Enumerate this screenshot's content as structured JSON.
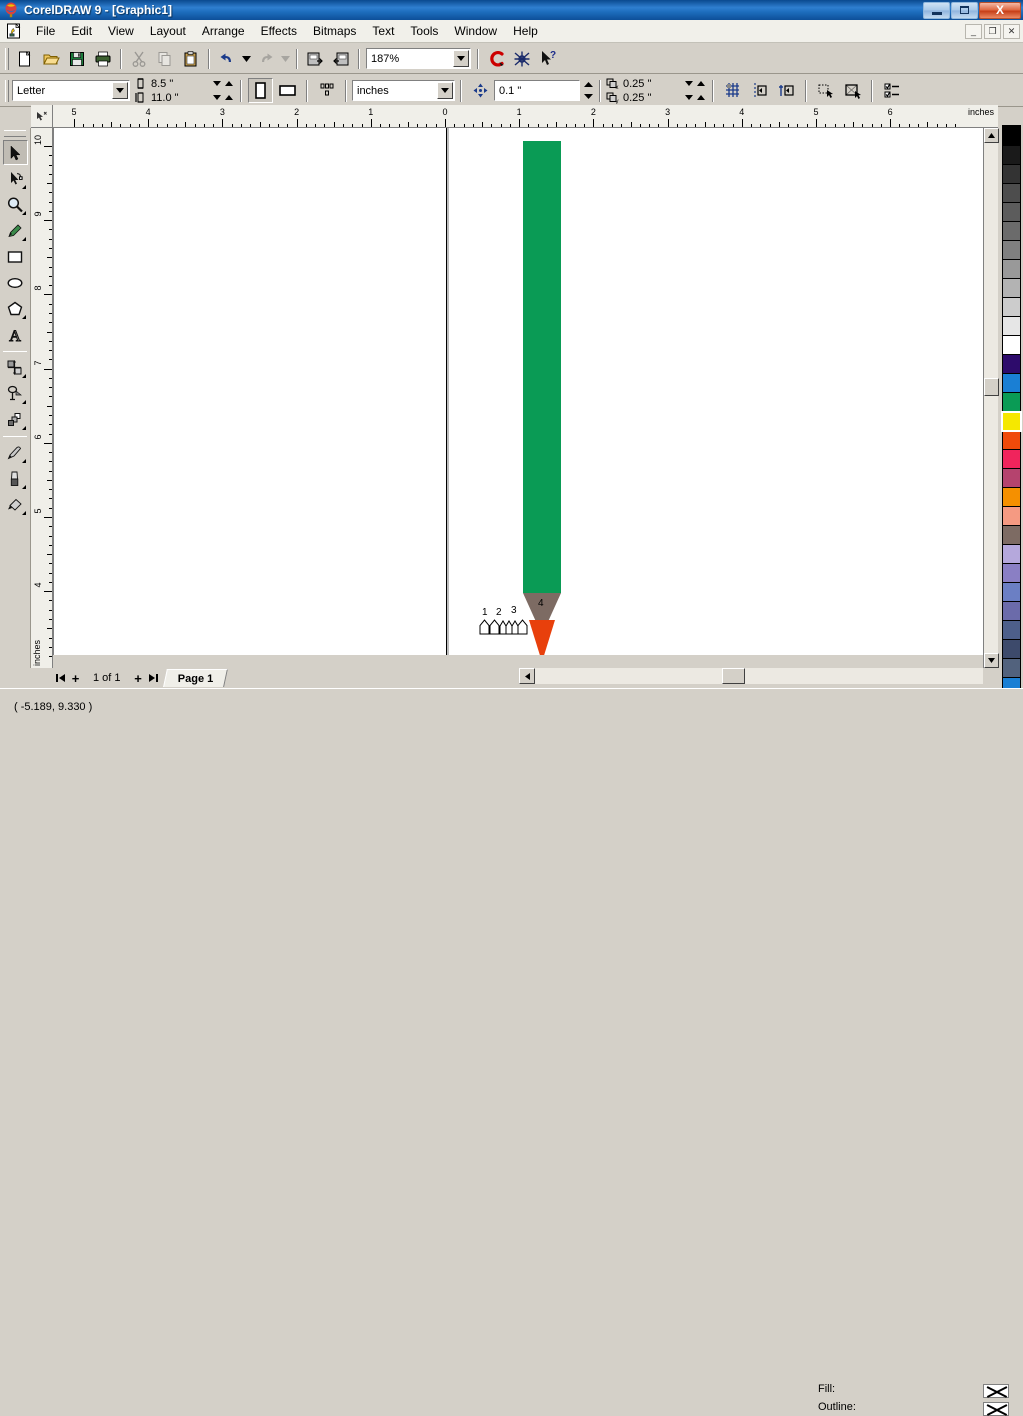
{
  "window": {
    "title": "CorelDRAW 9 - [Graphic1]",
    "app_icon": "corel-balloon-icon",
    "buttons": {
      "minimize": "minimize-icon",
      "restore": "restore-icon",
      "close": "X"
    },
    "doc_buttons": {
      "minimize": "_",
      "restore": "❐",
      "close": "✕"
    }
  },
  "menu": {
    "doc_icon": "document-icon",
    "items": [
      {
        "label": "File"
      },
      {
        "label": "Edit"
      },
      {
        "label": "View"
      },
      {
        "label": "Layout"
      },
      {
        "label": "Arrange"
      },
      {
        "label": "Effects"
      },
      {
        "label": "Bitmaps"
      },
      {
        "label": "Text"
      },
      {
        "label": "Tools"
      },
      {
        "label": "Window"
      },
      {
        "label": "Help"
      }
    ]
  },
  "toolbar": {
    "buttons": [
      {
        "name": "new-icon",
        "title": "New"
      },
      {
        "name": "open-icon",
        "title": "Open"
      },
      {
        "name": "save-icon",
        "title": "Save"
      },
      {
        "name": "print-icon",
        "title": "Print"
      },
      {
        "name": "cut-icon",
        "title": "Cut"
      },
      {
        "name": "copy-icon",
        "title": "Copy"
      },
      {
        "name": "paste-icon",
        "title": "Paste"
      },
      {
        "name": "undo-icon",
        "title": "Undo"
      },
      {
        "name": "redo-icon",
        "title": "Redo"
      },
      {
        "name": "import-icon",
        "title": "Import"
      },
      {
        "name": "export-icon",
        "title": "Export"
      },
      {
        "name": "application-launcher-icon",
        "title": "Application Launcher"
      },
      {
        "name": "corel-online-icon",
        "title": "Corel Online"
      },
      {
        "name": "whats-this-help-icon",
        "title": "What's This?"
      }
    ],
    "zoom_value": "187%"
  },
  "property_bar": {
    "paper_type": "Letter",
    "paper_width": "8.5 \"",
    "paper_height": "11.0 \"",
    "orientation_portrait": "portrait-icon",
    "orientation_landscape": "landscape-icon",
    "page_layout": "page-layout-icon",
    "units": "inches",
    "nudge_label": "nudge-icon",
    "nudge_offset": "0.1 \"",
    "duplicate_x_label": "x",
    "duplicate_x": "0.25 \"",
    "duplicate_y_label": "y",
    "duplicate_y": "0.25 \"",
    "buttons": [
      {
        "name": "snap-to-grid-icon"
      },
      {
        "name": "snap-to-guidelines-icon"
      },
      {
        "name": "snap-to-objects-icon"
      },
      {
        "name": "treat-as-filled-icon"
      },
      {
        "name": "wireframe-icon"
      },
      {
        "name": "options-icon"
      }
    ]
  },
  "toolbox": {
    "tools": [
      {
        "name": "pick-tool",
        "label": "Pick Tool",
        "active": true,
        "flyout": false
      },
      {
        "name": "shape-tool",
        "label": "Shape Tool",
        "active": false,
        "flyout": true
      },
      {
        "name": "zoom-tool",
        "label": "Zoom Tool",
        "active": false,
        "flyout": true
      },
      {
        "name": "freehand-tool",
        "label": "Freehand Tool",
        "active": false,
        "flyout": true
      },
      {
        "name": "rectangle-tool",
        "label": "Rectangle Tool",
        "active": false,
        "flyout": false
      },
      {
        "name": "ellipse-tool",
        "label": "Ellipse Tool",
        "active": false,
        "flyout": false
      },
      {
        "name": "polygon-tool",
        "label": "Polygon Tool",
        "active": false,
        "flyout": true
      },
      {
        "name": "text-tool",
        "label": "Text Tool",
        "active": false,
        "flyout": false
      },
      {
        "name": "interactive-blend-tool",
        "label": "Interactive Blend Tool",
        "active": false,
        "flyout": true
      },
      {
        "name": "eyedropper-tool",
        "label": "Eyedropper Tool",
        "active": false,
        "flyout": true
      },
      {
        "name": "interactive-extrude-tool",
        "label": "Interactive Extrude Tool",
        "active": false,
        "flyout": true
      },
      {
        "name": "outline-tool",
        "label": "Outline Tool",
        "active": false,
        "flyout": true
      },
      {
        "name": "fill-tool",
        "label": "Fill Tool",
        "active": false,
        "flyout": true
      },
      {
        "name": "interactive-fill-tool",
        "label": "Interactive Fill Tool",
        "active": false,
        "flyout": true
      }
    ]
  },
  "rulers": {
    "unit_label": "inches",
    "horizontal_labels": [
      "5",
      "4",
      "3",
      "2",
      "1",
      "0",
      "1",
      "2",
      "3",
      "4",
      "5",
      "6"
    ],
    "vertical_labels": [
      "10",
      "9",
      "8",
      "7",
      "6",
      "5",
      "4"
    ]
  },
  "canvas": {
    "artwork": {
      "name": "pencil-drawing",
      "body_color": "#0a9b55",
      "wood_color": "#7d6b63",
      "lead_color": "#e8400c"
    },
    "node_markers": {
      "labels": [
        "1",
        "2",
        "3",
        "4"
      ],
      "shape": "pentagon-node-icon"
    }
  },
  "palette": {
    "no_color": "no-color-icon",
    "selected_index": 15,
    "swatches": [
      "#000000",
      "#1a1a1a",
      "#333333",
      "#4d4d4d",
      "#5c5c5c",
      "#6b6b6b",
      "#808080",
      "#999999",
      "#b3b3b3",
      "#cccccc",
      "#e6e6e6",
      "#ffffff",
      "#2d0b6b",
      "#1a7fd4",
      "#0a9b55",
      "#f5e800",
      "#f04a0a",
      "#f0245c",
      "#b5436e",
      "#f59000",
      "#f59a82",
      "#7d6b63",
      "#b5a8dc",
      "#8a7fc4",
      "#6b7fc4",
      "#6b6baa",
      "#4d5f8a",
      "#3d4a6b",
      "#52627d",
      "#1a7fd4"
    ],
    "scroll_down": "scroll-down-icon",
    "scroll_home": "scroll-home-icon"
  },
  "page_nav": {
    "first": "first-page-icon",
    "add_before": "+",
    "page_count": "1 of 1",
    "add_after": "+",
    "last": "last-page-icon",
    "tab_label": "Page 1"
  },
  "status": {
    "coordinates": "( -5.189, 9.330 )",
    "fill_label": "Fill:",
    "outline_label": "Outline:",
    "fill_value": "none",
    "outline_value": "none"
  }
}
